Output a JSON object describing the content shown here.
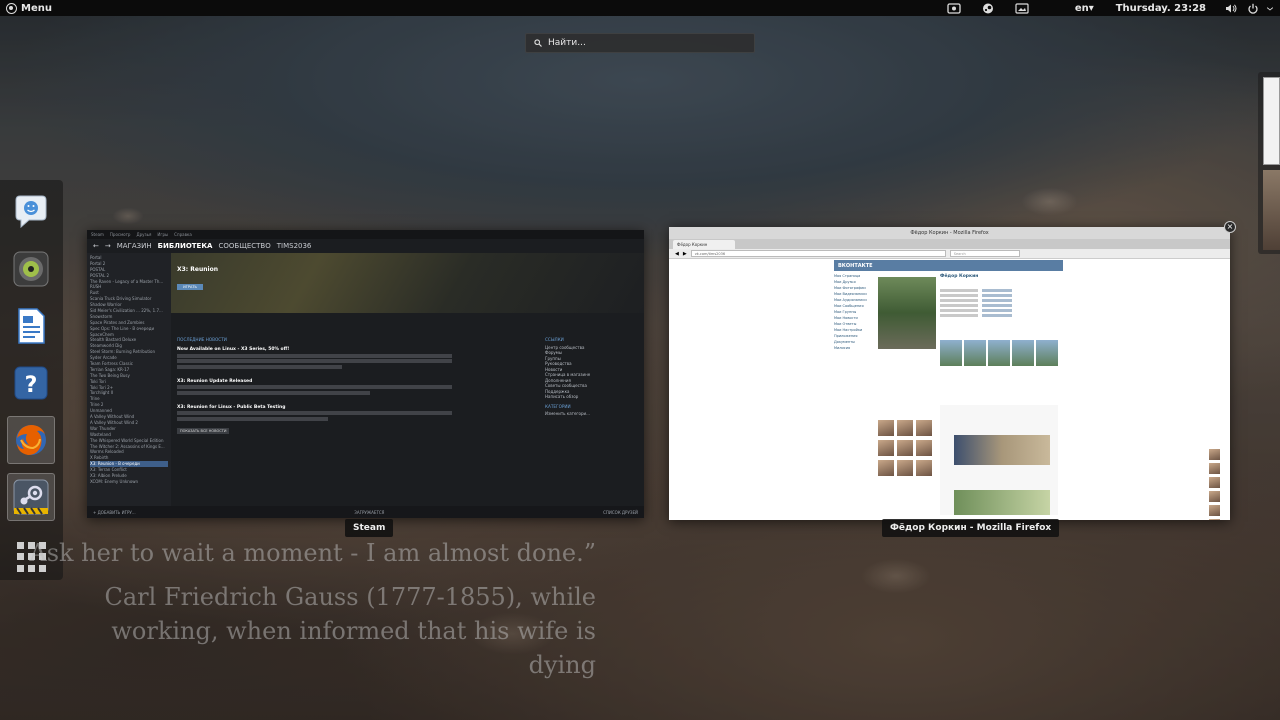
{
  "top_panel": {
    "menu_label": "Menu",
    "language": "en▾",
    "clock": "Thursday. 23:28"
  },
  "search": {
    "placeholder": "Найти..."
  },
  "dash": {
    "apps": [
      "empathy-icon",
      "rhythmbox-icon",
      "libreoffice-writer-icon",
      "help-icon",
      "firefox-icon",
      "steam-icon"
    ]
  },
  "windows": {
    "steam": {
      "label": "Steam",
      "menu": [
        "Steam",
        "Просмотр",
        "Друзья",
        "Игры",
        "Справка"
      ],
      "nav": [
        "←",
        "→",
        "МАГАЗИН",
        "БИБЛИОТЕКА",
        "СООБЩЕСТВО",
        "TIMS2036"
      ],
      "library_sidebar": [
        "Portal",
        "Portal 2",
        "POSTAL",
        "POSTAL 2",
        "The Raven - Legacy of a Master Th...",
        "RUSH",
        "Rust",
        "Scania Truck Driving Simulator",
        "Shadow Warrior",
        "Sid Meier's Civilization ... 22%, 1.7...",
        "Snowstorm",
        "Space Pirates and Zombies",
        "Spec Ops: The Line - В очереди",
        "SpaceChem",
        "Stealth Bastard Deluxe",
        "Steamworld Dig",
        "Steel Storm: Burning Retribution",
        "Syder Arcade",
        "Team Fortress Classic",
        "Terrian Saga: KR-17",
        "The Two Being Busy",
        "Toki Tori",
        "Toki Tori 2+",
        "Torchlight II",
        "Trine",
        "Trine 2",
        "Unmanned",
        "A Valley Without Wind",
        "A Valley Without Wind 2",
        "War Thunder",
        "Wasteland",
        "The Whispered World Special Edition",
        "The Witcher 2: Assassins of Kings E...",
        "Worms Reloaded",
        "X Rebirth",
        "X3: Reunion - В очереди",
        "X3: Terran Conflict",
        "X3: Albion Prelude",
        "XCOM: Enemy Unknown"
      ],
      "selected_index": 35,
      "game_title": "X3: Reunion",
      "play_button": "ИГРАТЬ",
      "news_section": "ПОСЛЕДНИЕ НОВОСТИ",
      "news": [
        "Now Available on Linux - X3 Series, 50% off!",
        "X3: Reunion Update Released",
        "X3: Reunion for Linux - Public Beta Testing"
      ],
      "all_news_button": "ПОКАЗАТЬ ВСЕ НОВОСТИ",
      "links_section": "ССЫЛКИ",
      "links": [
        "Центр сообщества",
        "Форумы",
        "Группы",
        "Руководства",
        "Новости",
        "Страница в магазине",
        "Дополнения",
        "Советы сообщества",
        "Поддержка",
        "Написать обзор"
      ],
      "categories_section": "КАТЕГОРИИ",
      "categories_link": "Изменить категори...",
      "add_game": "+ ДОБАВИТЬ ИГРУ...",
      "downloads": "ЗАГРУЖАЕТСЯ",
      "friends_list": "СПИСОК ДРУЗЕЙ"
    },
    "firefox": {
      "label": "Фёдор Коркин - Mozilla Firefox",
      "window_title": "Фёдор Коркин - Mozilla Firefox",
      "tab_title": "Фёдор Коркин",
      "url": "vk.com/tims2036",
      "search_placeholder": "Search",
      "site_logo": "ВКОНТАКТЕ",
      "profile_name": "Фёдор Коркин",
      "left_menu": [
        "Моя Страница",
        "Мои Друзья",
        "Мои Фотографии",
        "Мои Видеозаписи",
        "Мои Аудиозаписи",
        "Мои Сообщения",
        "Мои Группы",
        "Мои Новости",
        "Мои Ответы",
        "Мои Настройки",
        "Приложения",
        "Документы",
        "Милисия"
      ]
    }
  },
  "quote": {
    "line1": "Ask her to wait a moment - I am almost done.”",
    "line2": "Carl Friedrich Gauss (1777-1855), while working, when informed that his wife is dying"
  }
}
